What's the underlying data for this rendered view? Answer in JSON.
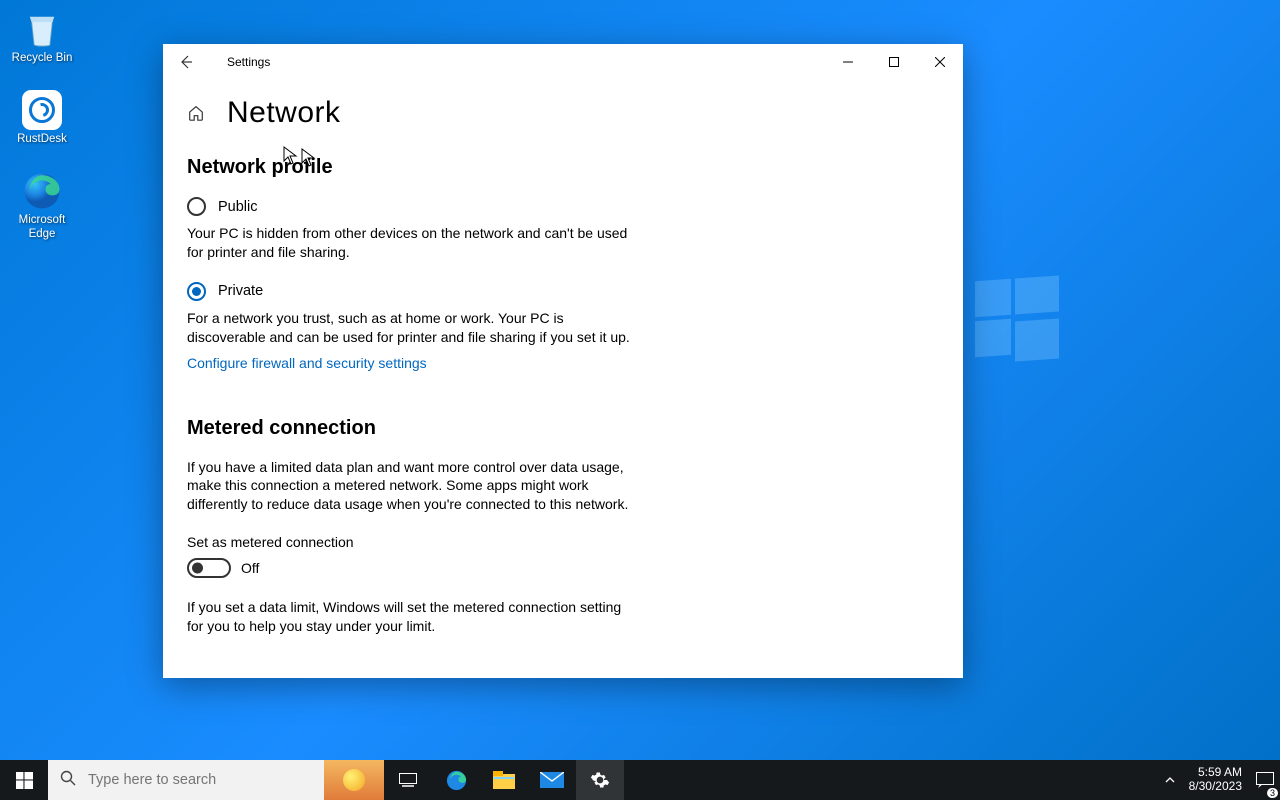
{
  "desktop": {
    "icons": [
      {
        "name": "recycle-bin",
        "label": "Recycle Bin"
      },
      {
        "name": "rustdesk",
        "label": "RustDesk"
      },
      {
        "name": "edge",
        "label": "Microsoft Edge"
      }
    ]
  },
  "window": {
    "app_name": "Settings",
    "page_title": "Network",
    "sections": {
      "profile": {
        "heading": "Network profile",
        "public": {
          "label": "Public",
          "desc": "Your PC is hidden from other devices on the network and can't be used for printer and file sharing.",
          "selected": false
        },
        "private": {
          "label": "Private",
          "desc": "For a network you trust, such as at home or work. Your PC is discoverable and can be used for printer and file sharing if you set it up.",
          "selected": true
        },
        "firewall_link": "Configure firewall and security settings"
      },
      "metered": {
        "heading": "Metered connection",
        "intro": "If you have a limited data plan and want more control over data usage, make this connection a metered network. Some apps might work differently to reduce data usage when you're connected to this network.",
        "toggle_label": "Set as metered connection",
        "toggle_state": "Off",
        "limit_desc": "If you set a data limit, Windows will set the metered connection setting for you to help you stay under your limit."
      }
    }
  },
  "taskbar": {
    "search_placeholder": "Type here to search",
    "time": "5:59 AM",
    "date": "8/30/2023",
    "notifications": "3"
  }
}
